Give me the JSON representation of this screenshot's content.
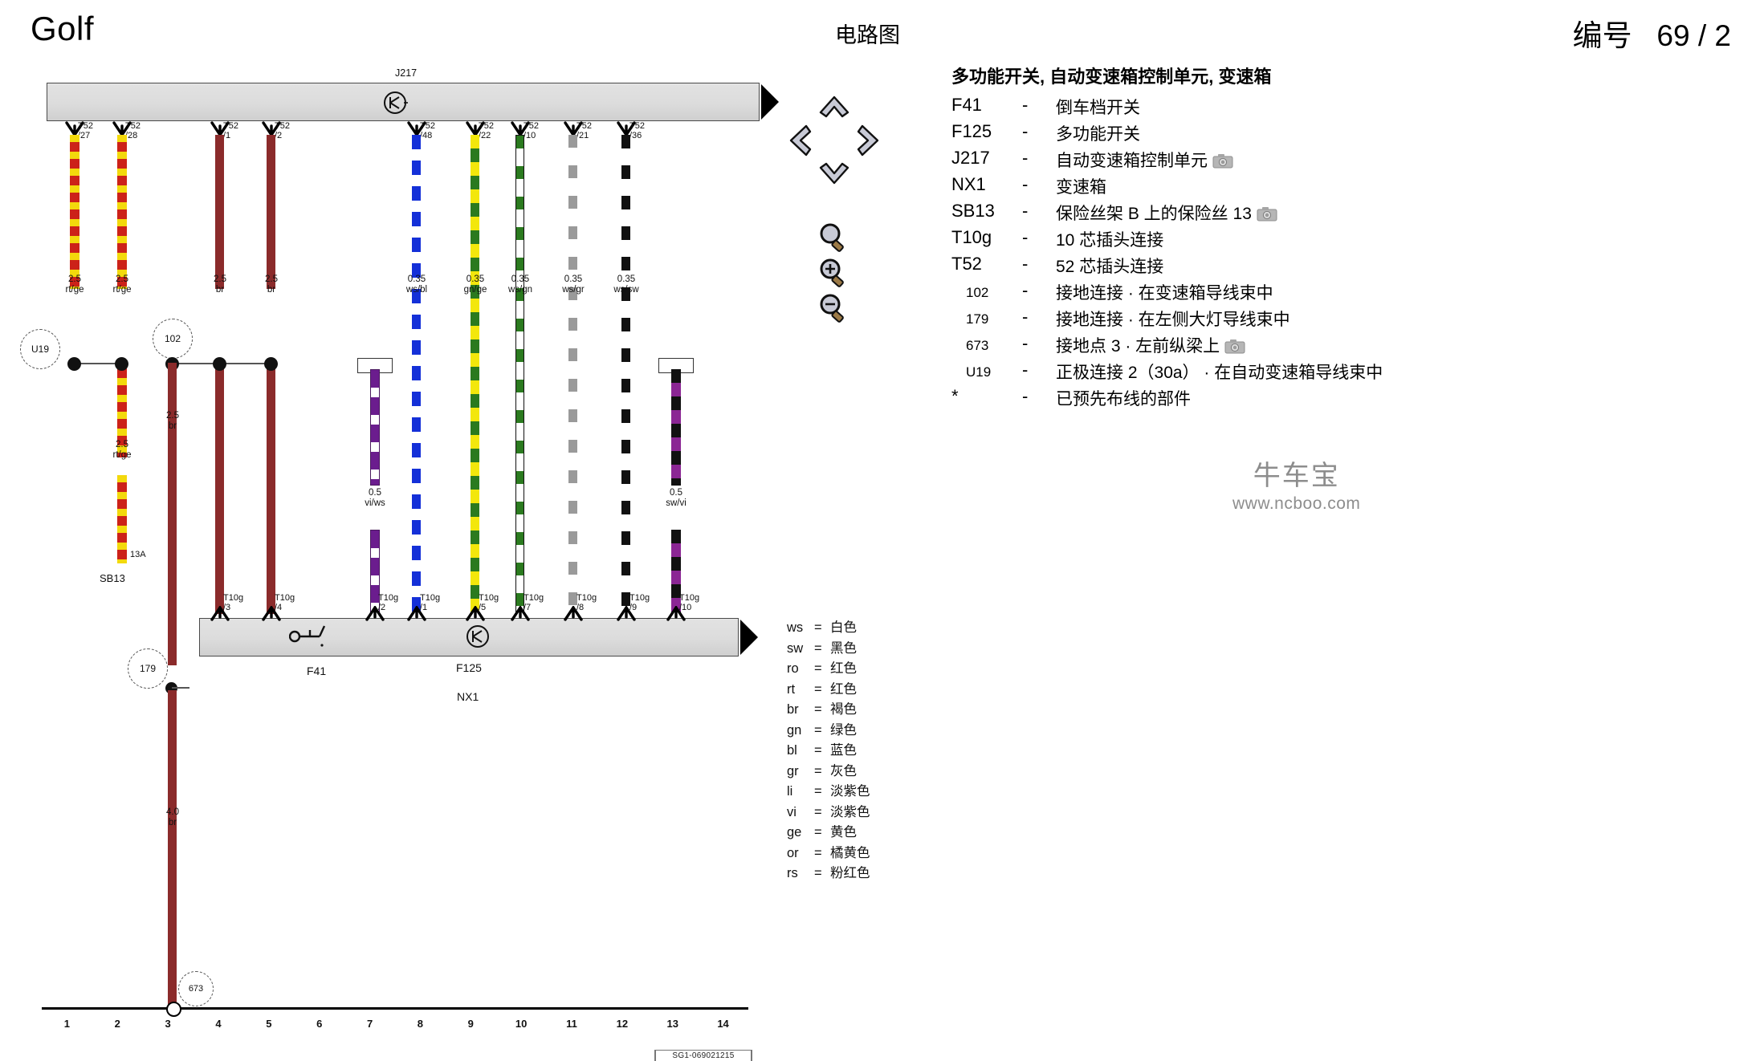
{
  "header": {
    "model": "Golf",
    "center_title": "电路图",
    "number_label": "编号",
    "number_value": "69 / 2"
  },
  "legend": {
    "title": "多功能开关, 自动变速箱控制单元, 变速箱",
    "dash": "-",
    "items": [
      {
        "code": "F41",
        "sub": false,
        "desc": "倒车档开关",
        "camera": false
      },
      {
        "code": "F125",
        "sub": false,
        "desc": "多功能开关",
        "camera": false
      },
      {
        "code": "J217",
        "sub": false,
        "desc": "自动变速箱控制单元",
        "camera": true
      },
      {
        "code": "NX1",
        "sub": false,
        "desc": "变速箱",
        "camera": false
      },
      {
        "code": "SB13",
        "sub": false,
        "desc": "保险丝架 B 上的保险丝 13",
        "camera": true
      },
      {
        "code": "T10g",
        "sub": false,
        "desc": "10 芯插头连接",
        "camera": false
      },
      {
        "code": "T52",
        "sub": false,
        "desc": "52 芯插头连接",
        "camera": false
      },
      {
        "code": "102",
        "sub": true,
        "desc": "接地连接 · 在变速箱导线束中",
        "camera": false
      },
      {
        "code": "179",
        "sub": true,
        "desc": "接地连接 · 在左侧大灯导线束中",
        "camera": false
      },
      {
        "code": "673",
        "sub": true,
        "desc": "接地点 3 · 左前纵梁上",
        "camera": true
      },
      {
        "code": "U19",
        "sub": true,
        "desc": "正极连接 2（30a） · 在自动变速箱导线束中",
        "camera": false
      },
      {
        "code": "*",
        "sub": false,
        "desc": "已预先布线的部件",
        "camera": false
      }
    ]
  },
  "watermark": {
    "brand": "牛车宝",
    "url": "www.ncboo.com"
  },
  "color_key": {
    "eq": "=",
    "rows": [
      {
        "abbr": "ws",
        "name": "白色"
      },
      {
        "abbr": "sw",
        "name": "黑色"
      },
      {
        "abbr": "ro",
        "name": "红色"
      },
      {
        "abbr": "rt",
        "name": "红色"
      },
      {
        "abbr": "br",
        "name": "褐色"
      },
      {
        "abbr": "gn",
        "name": "绿色"
      },
      {
        "abbr": "bl",
        "name": "蓝色"
      },
      {
        "abbr": "gr",
        "name": "灰色"
      },
      {
        "abbr": "li",
        "name": "淡紫色"
      },
      {
        "abbr": "vi",
        "name": "淡紫色"
      },
      {
        "abbr": "ge",
        "name": "黄色"
      },
      {
        "abbr": "or",
        "name": "橘黄色"
      },
      {
        "abbr": "rs",
        "name": "粉红色"
      }
    ]
  },
  "tools": [
    {
      "name": "pan-up",
      "glyph": "up"
    },
    {
      "name": "pan-left",
      "glyph": "left"
    },
    {
      "name": "pan-right",
      "glyph": "right"
    },
    {
      "name": "pan-down",
      "glyph": "down"
    },
    {
      "name": "zoom-fit",
      "glyph": "mag"
    },
    {
      "name": "zoom-in",
      "glyph": "mag-plus"
    },
    {
      "name": "zoom-out",
      "glyph": "mag-minus"
    }
  ],
  "diagram": {
    "top_connector_label": "J217",
    "bottom_connector_labels": {
      "f41": "F41",
      "f125": "F125",
      "nx1": "NX1"
    },
    "top_terminals": [
      {
        "connector": "T52",
        "pin": "/27",
        "gauge": "2.5",
        "color_code": "rt/ge"
      },
      {
        "connector": "T52",
        "pin": "/28",
        "gauge": "2.5",
        "color_code": "rt/ge"
      },
      {
        "connector": "T52",
        "pin": "/1",
        "gauge": "2.5",
        "color_code": "br"
      },
      {
        "connector": "T52",
        "pin": "/2",
        "gauge": "2.5",
        "color_code": "br"
      },
      {
        "connector": "T52",
        "pin": "/48",
        "gauge": "0.35",
        "color_code": "ws/bl"
      },
      {
        "connector": "T52",
        "pin": "/22",
        "gauge": "0.35",
        "color_code": "gn/ge"
      },
      {
        "connector": "T52",
        "pin": "/10",
        "gauge": "0.35",
        "color_code": "ws/gn"
      },
      {
        "connector": "T52",
        "pin": "/21",
        "gauge": "0.35",
        "color_code": "ws/gr"
      },
      {
        "connector": "T52",
        "pin": "/36",
        "gauge": "0.35",
        "color_code": "ws/sw"
      }
    ],
    "bottom_terminals": [
      {
        "connector": "T10g",
        "pin": "/3"
      },
      {
        "connector": "T10g",
        "pin": "/4"
      },
      {
        "connector": "T10g",
        "pin": "/2"
      },
      {
        "connector": "T10g",
        "pin": "/1"
      },
      {
        "connector": "T10g",
        "pin": "/5"
      },
      {
        "connector": "T10g",
        "pin": "/7"
      },
      {
        "connector": "T10g",
        "pin": "/8"
      },
      {
        "connector": "T10g",
        "pin": "/9"
      },
      {
        "connector": "T10g",
        "pin": "/10"
      }
    ],
    "mid_wires": [
      {
        "gauge": "0.5",
        "color_code": "vi/ws"
      },
      {
        "gauge": "0.5",
        "color_code": "sw/vi"
      }
    ],
    "branch_labels": [
      {
        "text": "2.5",
        "sub": "rt/ge"
      },
      {
        "text": "2.5",
        "sub": "br"
      },
      {
        "text": "4.0",
        "sub": "br"
      }
    ],
    "refs": {
      "u19": "U19",
      "n102": "102",
      "n179": "179",
      "n673": "673"
    },
    "fuse": {
      "rating": "13A",
      "label": "SB13"
    },
    "rail_numbers": [
      "1",
      "2",
      "3",
      "4",
      "5",
      "6",
      "7",
      "8",
      "9",
      "10",
      "11",
      "12",
      "13",
      "14"
    ],
    "sheet_code": "SG1-069021215"
  }
}
